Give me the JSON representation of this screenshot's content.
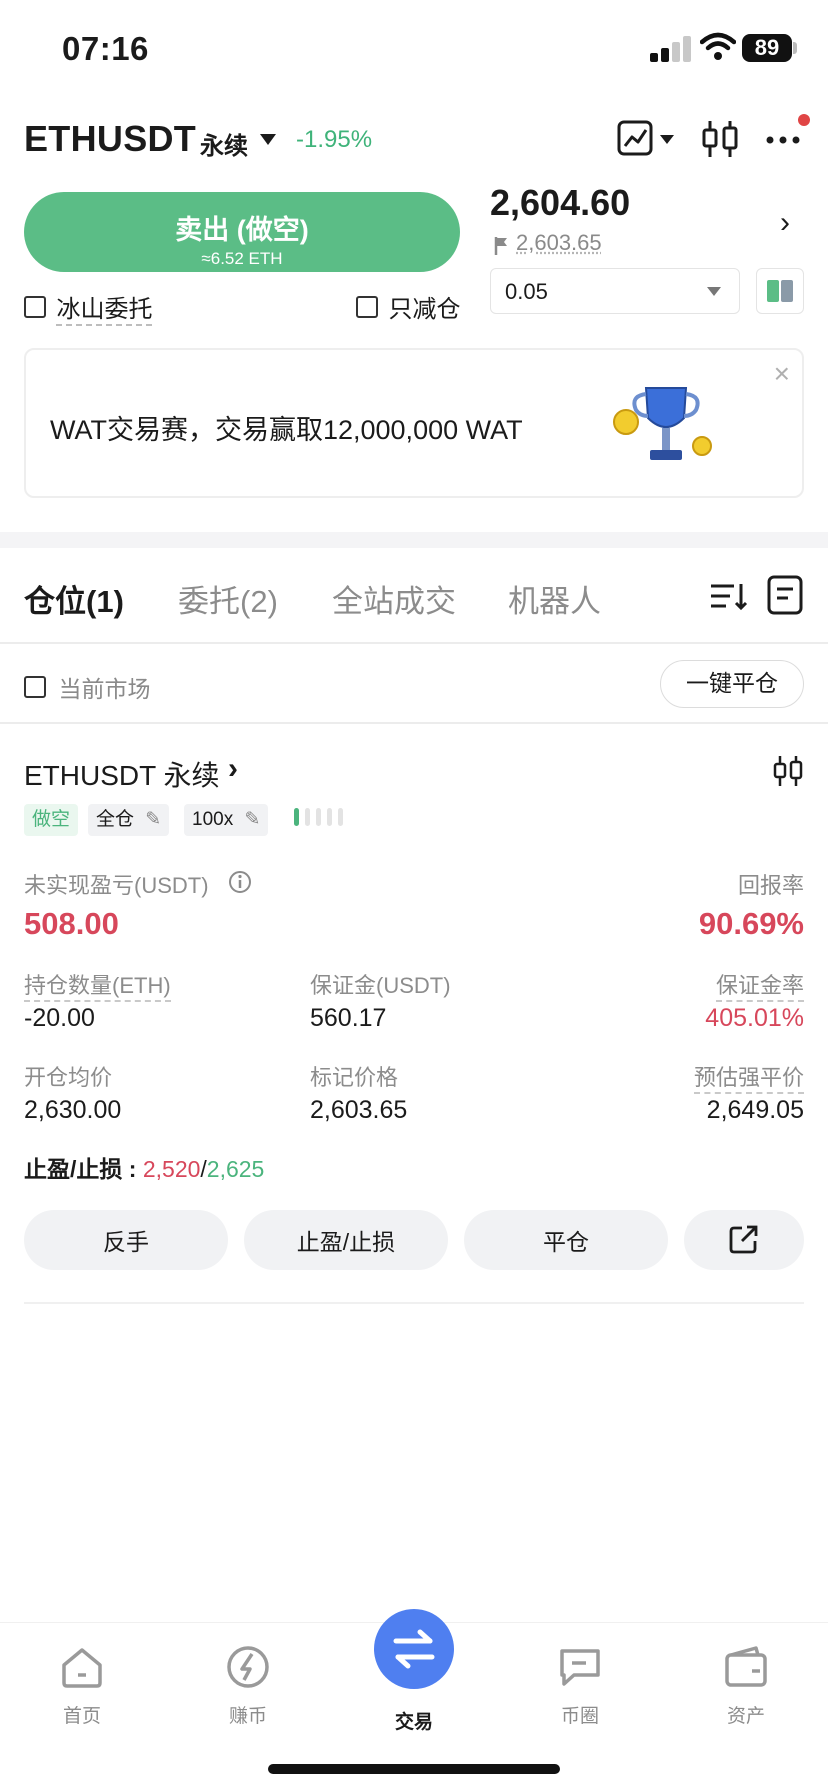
{
  "status_bar": {
    "time": "07:16",
    "battery": "89"
  },
  "header": {
    "symbol": "ETHUSDT",
    "contract_type": "永续",
    "change": "-1.95%"
  },
  "trade": {
    "sell_label": "卖出 (做空)",
    "sell_sub": "≈6.52 ETH",
    "iceberg_label": "冰山委托",
    "reduce_only_label": "只减仓",
    "last_price": "2,604.60",
    "mark_price": "2,603.65",
    "quantity": "0.05"
  },
  "banner": {
    "text": "WAT交易赛，交易赢取12,000,000 WAT",
    "close": "×"
  },
  "tabs": [
    {
      "label": "仓位(1)"
    },
    {
      "label": "委托(2)"
    },
    {
      "label": "全站成交"
    },
    {
      "label": "机器人"
    }
  ],
  "filter": {
    "current_market_label": "当前市场",
    "close_all_label": "一键平仓"
  },
  "position": {
    "title": "ETHUSDT 永续",
    "side_tag": "做空",
    "margin_mode": "全仓",
    "leverage": "100x",
    "risk_level": 0.2,
    "unrealized_pnl_label": "未实现盈亏(USDT)",
    "unrealized_pnl": "508.00",
    "roe_label": "回报率",
    "roe": "90.69%",
    "size_label": "持仓数量(ETH)",
    "size": "-20.00",
    "margin_label": "保证金(USDT)",
    "margin": "560.17",
    "margin_ratio_label": "保证金率",
    "margin_ratio": "405.01%",
    "entry_label": "开仓均价",
    "entry": "2,630.00",
    "mark_label": "标记价格",
    "mark": "2,603.65",
    "liq_label": "预估强平价",
    "liq": "2,649.05",
    "tpsl_label": "止盈/止损 : ",
    "tp": "2,520",
    "sl": "2,625"
  },
  "actions": {
    "reverse": "反手",
    "tpsl": "止盈/止损",
    "close": "平仓"
  },
  "nav": [
    {
      "label": "首页"
    },
    {
      "label": "赚币"
    },
    {
      "label": "交易"
    },
    {
      "label": "币圈"
    },
    {
      "label": "资产"
    }
  ],
  "colors": {
    "accent_green": "#5bbd86",
    "loss_red": "#d7475b",
    "nav_blue": "#4f7ff0"
  }
}
